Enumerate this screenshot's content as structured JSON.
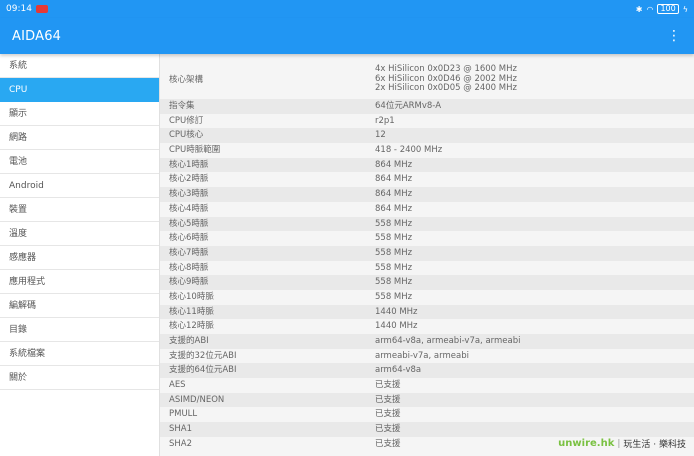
{
  "status": {
    "time": "09:14",
    "battery": "100"
  },
  "app": {
    "title": "AIDA64",
    "menu_glyph": "⋮"
  },
  "sidebar": {
    "items": [
      {
        "label": "系統"
      },
      {
        "label": "CPU"
      },
      {
        "label": "顯示"
      },
      {
        "label": "網路"
      },
      {
        "label": "電池"
      },
      {
        "label": "Android"
      },
      {
        "label": "裝置"
      },
      {
        "label": "溫度"
      },
      {
        "label": "感應器"
      },
      {
        "label": "應用程式"
      },
      {
        "label": "編解碼"
      },
      {
        "label": "目錄"
      },
      {
        "label": "系統檔案"
      },
      {
        "label": "關於"
      }
    ],
    "active_index": 1
  },
  "cpu": {
    "arch_key": "核心架構",
    "arch_lines": [
      "4x HiSilicon 0x0D23 @ 1600 MHz",
      "6x HiSilicon 0x0D46 @ 2002 MHz",
      "2x HiSilicon 0x0D05 @ 2400 MHz"
    ],
    "rows": [
      {
        "k": "指令集",
        "v": "64位元ARMv8-A"
      },
      {
        "k": "CPU修訂",
        "v": "r2p1"
      },
      {
        "k": "CPU核心",
        "v": "12"
      },
      {
        "k": "CPU時脈範圍",
        "v": "418 - 2400 MHz"
      },
      {
        "k": "核心1時脈",
        "v": "864 MHz"
      },
      {
        "k": "核心2時脈",
        "v": "864 MHz"
      },
      {
        "k": "核心3時脈",
        "v": "864 MHz"
      },
      {
        "k": "核心4時脈",
        "v": "864 MHz"
      },
      {
        "k": "核心5時脈",
        "v": "558 MHz"
      },
      {
        "k": "核心6時脈",
        "v": "558 MHz"
      },
      {
        "k": "核心7時脈",
        "v": "558 MHz"
      },
      {
        "k": "核心8時脈",
        "v": "558 MHz"
      },
      {
        "k": "核心9時脈",
        "v": "558 MHz"
      },
      {
        "k": "核心10時脈",
        "v": "558 MHz"
      },
      {
        "k": "核心11時脈",
        "v": "1440 MHz"
      },
      {
        "k": "核心12時脈",
        "v": "1440 MHz"
      },
      {
        "k": "支援的ABI",
        "v": "arm64-v8a, armeabi-v7a, armeabi"
      },
      {
        "k": "支援的32位元ABI",
        "v": "armeabi-v7a, armeabi"
      },
      {
        "k": "支援的64位元ABI",
        "v": "arm64-v8a"
      },
      {
        "k": "AES",
        "v": "已支援"
      },
      {
        "k": "ASIMD/NEON",
        "v": "已支援"
      },
      {
        "k": "PMULL",
        "v": "已支援"
      },
      {
        "k": "SHA1",
        "v": "已支援"
      },
      {
        "k": "SHA2",
        "v": "已支援"
      }
    ]
  },
  "watermark": {
    "brand": "unwire.hk",
    "tagline": "玩生活 · 樂科技"
  },
  "colors": {
    "appbar": "#2196f3",
    "active_item": "#29a8f2"
  }
}
